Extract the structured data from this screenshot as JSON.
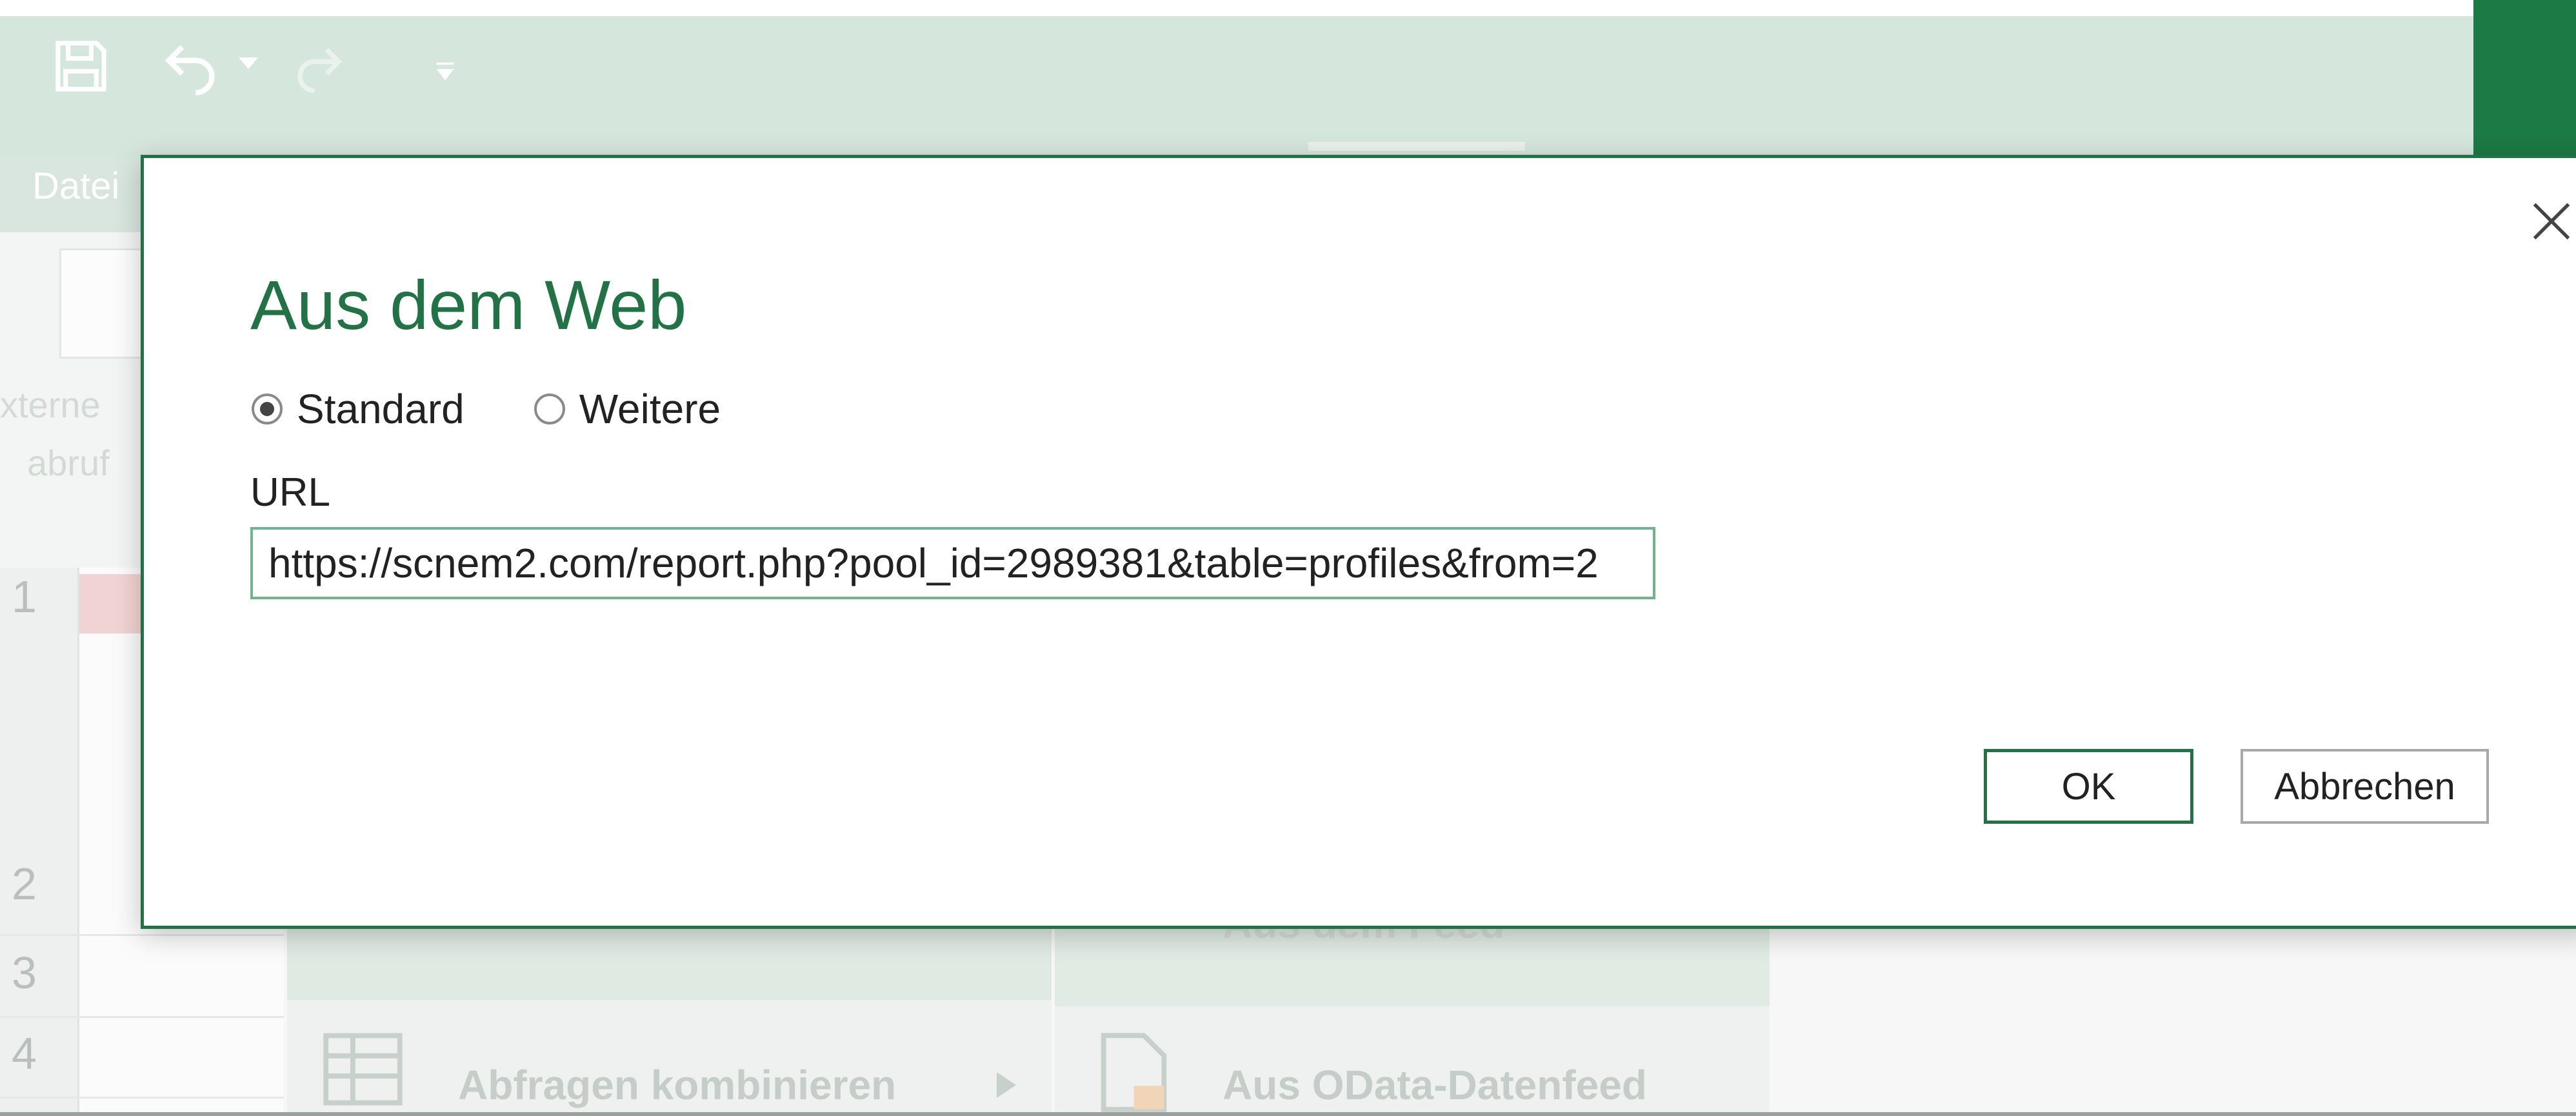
{
  "window": {
    "tab_file": "Datei",
    "accent_color": "#217346",
    "icons": [
      "save-icon",
      "undo-icon",
      "redo-icon",
      "customize-qat-icon"
    ]
  },
  "background": {
    "ribbon_text_1": "xterne",
    "ribbon_text_2": "abruf",
    "row_numbers": [
      "1",
      "2",
      "3",
      "4"
    ],
    "menu_items": [
      "Abfragen kombinieren",
      "Aus dem Feed",
      "Aus OData-Datenfeed"
    ]
  },
  "dialog": {
    "title": "Aus dem Web",
    "radio_standard": "Standard",
    "radio_more": "Weitere",
    "selected": "Standard",
    "url_label": "URL",
    "url_value": "https://scnem2.com/report.php?pool_id=2989381&table=profiles&from=2",
    "ok_label": "OK",
    "cancel_label": "Abbrechen"
  }
}
